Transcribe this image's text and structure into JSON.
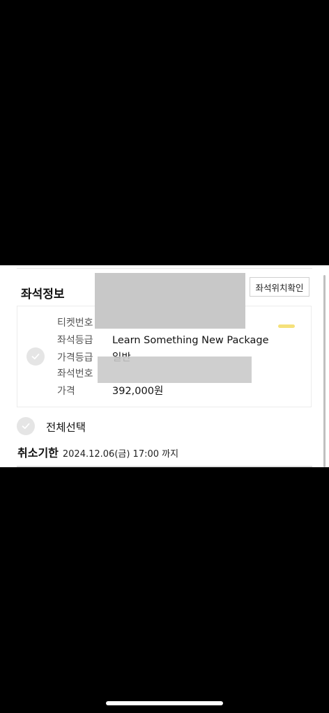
{
  "seat_info": {
    "title": "좌석정보",
    "seat_map_button": "좌석위치확인",
    "rows": [
      {
        "label": "티켓번호",
        "value": ""
      },
      {
        "label": "좌석등급",
        "value": "Learn Something New Package"
      },
      {
        "label": "가격등급",
        "value": "일반"
      },
      {
        "label": "좌석번호",
        "value": ""
      },
      {
        "label": "가격",
        "value": "392,000원"
      }
    ]
  },
  "select_all": {
    "label": "전체선택"
  },
  "cancel_deadline": {
    "title": "취소기한",
    "date": "2024.12.06(금) 17:00 까지"
  }
}
